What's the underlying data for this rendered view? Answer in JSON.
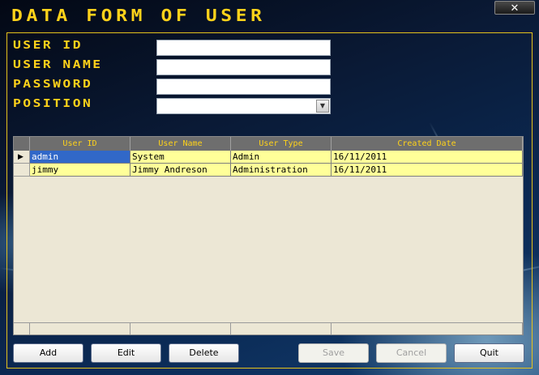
{
  "window": {
    "title": "DATA FORM OF USER",
    "close_glyph": "✕"
  },
  "form": {
    "user_id_label": "USER ID",
    "user_name_label": "USER NAME",
    "password_label": "PASSWORD",
    "position_label": "POSITION",
    "user_id_value": "",
    "user_name_value": "",
    "password_value": "",
    "position_value": "",
    "dropdown_icon": "chevron-down-icon"
  },
  "table": {
    "columns": [
      "User ID",
      "User Name",
      "User Type",
      "Created Date"
    ],
    "rows": [
      {
        "user_id": "admin",
        "user_name": "System",
        "user_type": "Admin",
        "created_date": "16/11/2011"
      },
      {
        "user_id": "jimmy",
        "user_name": "Jimmy Andreson",
        "user_type": "Administration",
        "created_date": "16/11/2011"
      }
    ],
    "current_row_marker": "▶",
    "row_highlight_color": "#ffff99",
    "selected_cell_color": "#3168c8"
  },
  "buttons": {
    "add": "Add",
    "edit": "Edit",
    "delete": "Delete",
    "save": "Save",
    "cancel": "Cancel",
    "quit": "Quit"
  },
  "colors": {
    "accent": "#ffd21a",
    "frame": "#e6c21c"
  }
}
